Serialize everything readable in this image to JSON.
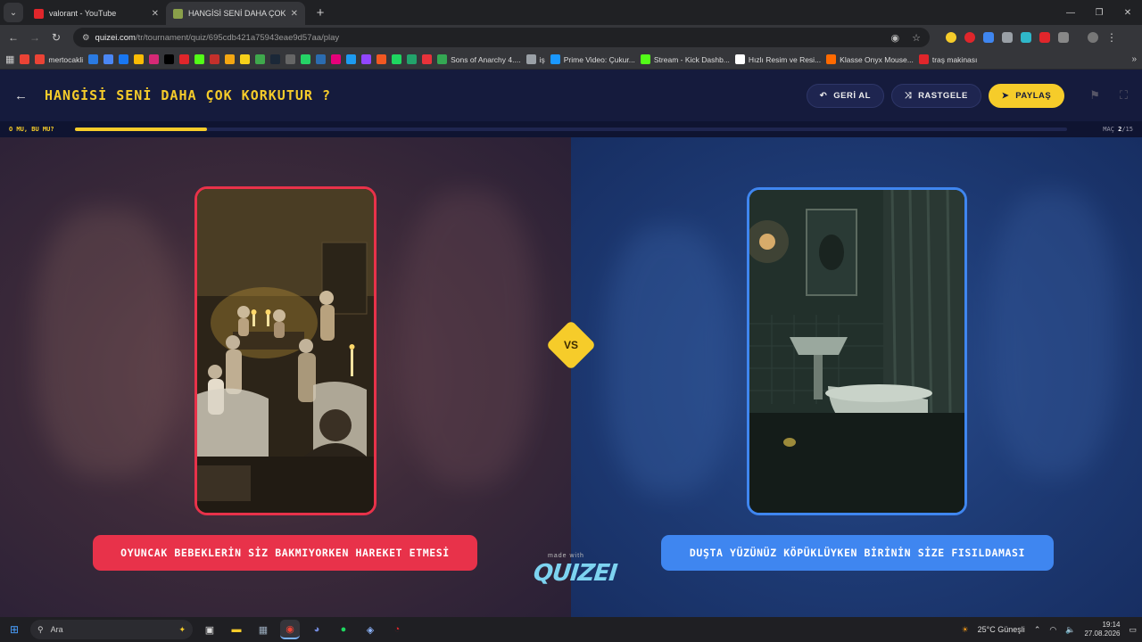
{
  "browser": {
    "tabs": [
      {
        "title": "valorant - YouTube",
        "favicon_color": "#e0262b",
        "active": false
      },
      {
        "title": "HANGİSİ SENİ DAHA ÇOK KORK",
        "favicon_color": "#8aa04a",
        "active": true
      }
    ],
    "new_tab_symbol": "+",
    "url_host": "quizei.com",
    "url_path": "/tr/tournament/quiz/695cdb421a75943eae9d57aa/play",
    "bookmarks": [
      {
        "label": "",
        "color": "#ea4335"
      },
      {
        "label": "mertocakli",
        "color": "#ea4335"
      },
      {
        "label": "",
        "color": "#2a7ae2"
      },
      {
        "label": "",
        "color": "#4b87f5"
      },
      {
        "label": "",
        "color": "#1877f2"
      },
      {
        "label": "",
        "color": "#fbbc05"
      },
      {
        "label": "",
        "color": "#d62976"
      },
      {
        "label": "",
        "color": "#000000"
      },
      {
        "label": "",
        "color": "#e0262b"
      },
      {
        "label": "",
        "color": "#53fc18"
      },
      {
        "label": "",
        "color": "#c4302b"
      },
      {
        "label": "",
        "color": "#f3a712"
      },
      {
        "label": "",
        "color": "#f6d11a"
      },
      {
        "label": "",
        "color": "#3fa84c"
      },
      {
        "label": "",
        "color": "#1b2838"
      },
      {
        "label": "",
        "color": "#666666"
      },
      {
        "label": "",
        "color": "#25d366"
      },
      {
        "label": "",
        "color": "#2b6cb0"
      },
      {
        "label": "",
        "color": "#e6007a"
      },
      {
        "label": "",
        "color": "#1d9bf0"
      },
      {
        "label": "",
        "color": "#9146ff"
      },
      {
        "label": "",
        "color": "#f25822"
      },
      {
        "label": "",
        "color": "#1ed760"
      },
      {
        "label": "",
        "color": "#22a36b"
      },
      {
        "label": "",
        "color": "#e8323a"
      },
      {
        "label": "Sons of Anarchy 4....",
        "color": "#34a853"
      },
      {
        "label": "iş",
        "color": "#9aa0a6"
      },
      {
        "label": "Prime Video: Çukur...",
        "color": "#1a98ff"
      },
      {
        "label": "Stream - Kick Dashb...",
        "color": "#53fc18"
      },
      {
        "label": "Hızlı Resim ve Resi...",
        "color": "#ffffff"
      },
      {
        "label": "Klasse Onyx Mouse...",
        "color": "#ff6a00"
      },
      {
        "label": "traş makinası",
        "color": "#e0262b"
      }
    ]
  },
  "app": {
    "title": "HANGİSİ SENİ DAHA ÇOK KORKUTUR ?",
    "buttons": {
      "undo": "GERİ AL",
      "random": "RASTGELE",
      "share": "PAYLAŞ"
    },
    "progress_label": "O MU, BU MU?",
    "progress_fraction": 0.1333,
    "match_prefix": "MAÇ ",
    "match_current": "2",
    "match_total": "/15",
    "vs": "VS",
    "left_option": "OYUNCAK BEBEKLERİN SİZ BAKMIYORKEN HAREKET ETMESİ",
    "right_option": "DUŞTA YÜZÜNÜZ KÖPÜKLÜYKEN BİRİNİN SİZE FISILDAMASI",
    "made_with": "made with",
    "logo": "QUIZEI",
    "colors": {
      "accent": "#f6cc2a",
      "left": "#e8324a",
      "right": "#3f86f0",
      "header": "#151b3d"
    }
  },
  "taskbar": {
    "search_placeholder": "Ara",
    "weather": "25°C  Güneşli",
    "time": "19:14",
    "date": "27.08.2026"
  }
}
